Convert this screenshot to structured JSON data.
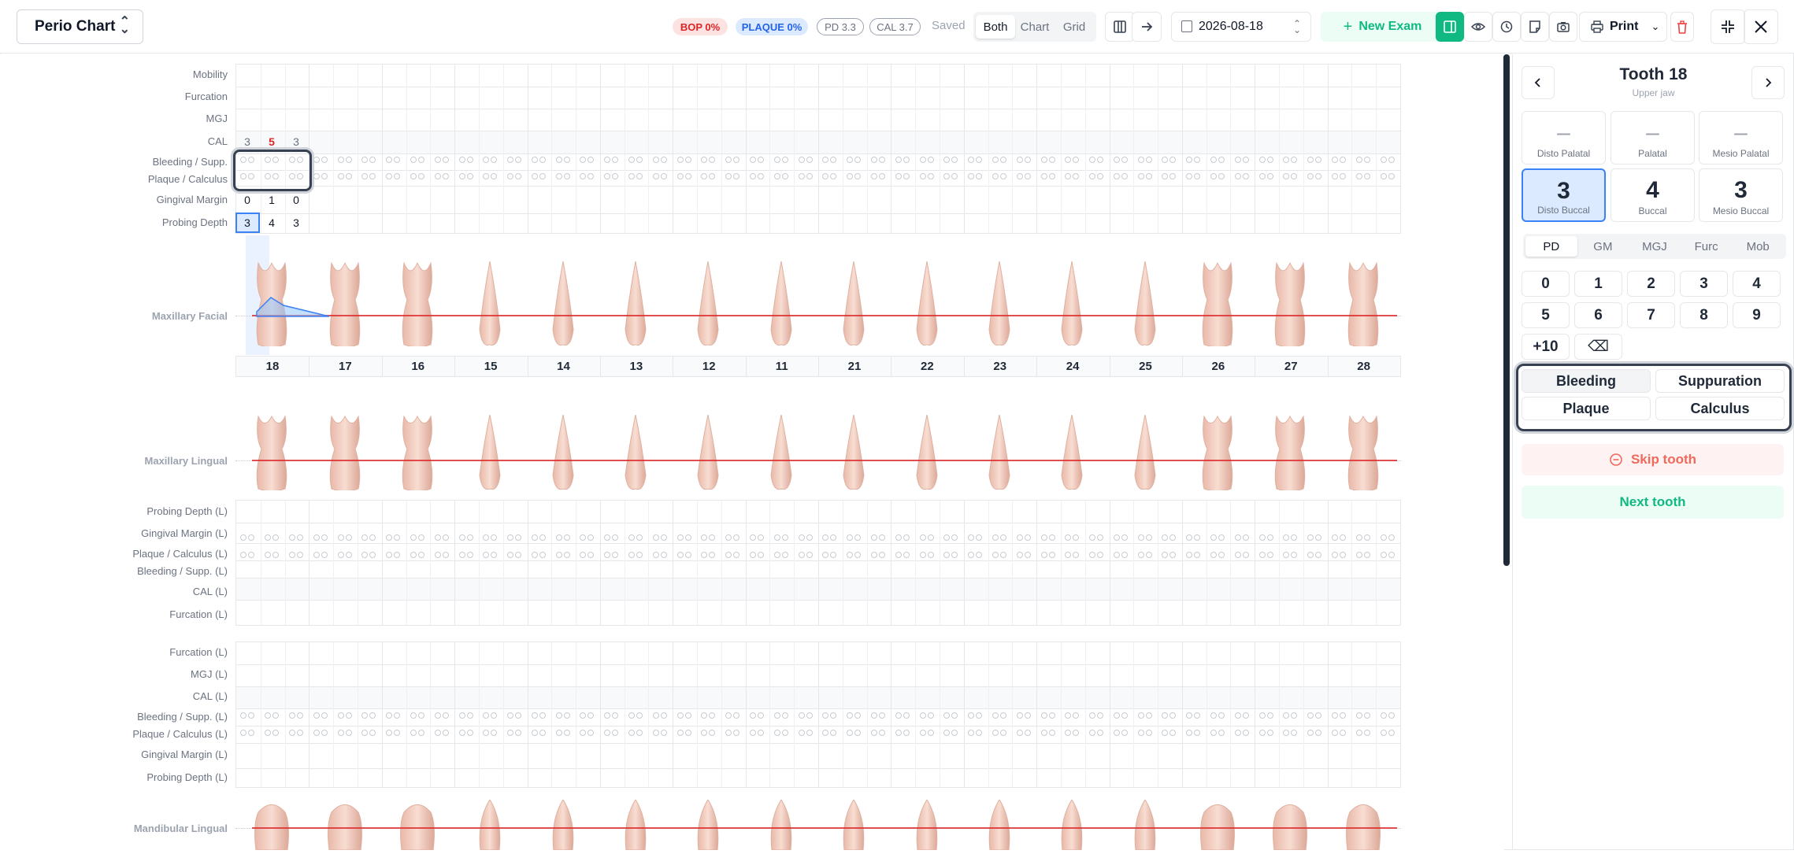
{
  "header": {
    "app_title": "Perio Chart",
    "stats": {
      "bop": "BOP 0%",
      "plaque": "PLAQUE 0%",
      "pd": "PD 3.3",
      "cal": "CAL 3.7"
    },
    "save_status": "Saved",
    "view_modes": [
      "Both",
      "Chart",
      "Grid"
    ],
    "active_view": "Both",
    "exam_date": "2026-08-18",
    "new_exam_label": "New Exam",
    "print_label": "Print"
  },
  "chart": {
    "upper_rows": [
      "Mobility",
      "Furcation",
      "MGJ",
      "CAL",
      "Bleeding / Supp.",
      "Plaque / Calculus",
      "Gingival Margin",
      "Probing Depth"
    ],
    "facial_label": "Maxillary Facial",
    "lingual_label": "Maxillary Lingual",
    "lingual_rows": [
      "Probing Depth (L)",
      "Gingival Margin (L)",
      "Plaque / Calculus (L)",
      "Bleeding / Supp. (L)",
      "CAL (L)",
      "Furcation (L)"
    ],
    "lower_rows": [
      "Furcation (L)",
      "MGJ (L)",
      "CAL (L)",
      "Bleeding / Supp. (L)",
      "Plaque / Calculus (L)",
      "Gingival Margin (L)",
      "Probing Depth (L)"
    ],
    "mandibular_label": "Mandibular Lingual",
    "teeth": [
      "18",
      "17",
      "16",
      "15",
      "14",
      "13",
      "12",
      "11",
      "21",
      "22",
      "23",
      "24",
      "25",
      "26",
      "27",
      "28"
    ],
    "tooth18": {
      "cal": [
        "3",
        "5",
        "3"
      ],
      "gingival_margin": [
        "0",
        "1",
        "0"
      ],
      "probing_depth": [
        "3",
        "4",
        "3"
      ]
    }
  },
  "panel": {
    "tooth_title": "Tooth 18",
    "jaw": "Upper jaw",
    "sites": [
      {
        "label": "Disto Palatal",
        "value": "–"
      },
      {
        "label": "Palatal",
        "value": "–"
      },
      {
        "label": "Mesio Palatal",
        "value": "–"
      },
      {
        "label": "Disto Buccal",
        "value": "3"
      },
      {
        "label": "Buccal",
        "value": "4"
      },
      {
        "label": "Mesio Buccal",
        "value": "3"
      }
    ],
    "measure_tabs": [
      "PD",
      "GM",
      "MGJ",
      "Furc",
      "Mob"
    ],
    "active_tab": "PD",
    "keypad": [
      "0",
      "1",
      "2",
      "3",
      "4",
      "5",
      "6",
      "7",
      "8",
      "9",
      "+10",
      "⌫"
    ],
    "flags": [
      "Bleeding",
      "Suppuration",
      "Plaque",
      "Calculus"
    ],
    "skip_label": "Skip tooth",
    "next_label": "Next tooth"
  },
  "colors": {
    "accent": "#10b981",
    "selection": "#3b82f6",
    "danger": "#dc2626",
    "gum_line": "#dc2626"
  }
}
